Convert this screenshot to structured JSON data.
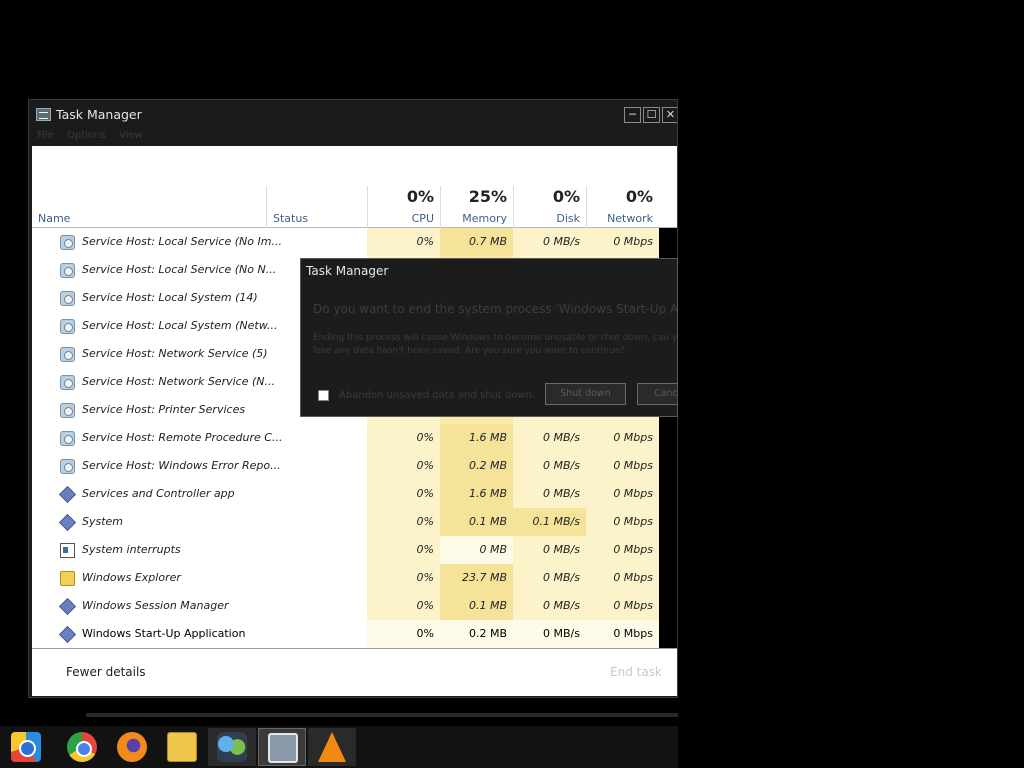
{
  "window": {
    "title": "Task Manager",
    "controls": {
      "minimize": "─",
      "maximize": "☐",
      "close": "✕"
    },
    "menu": [
      "File",
      "Options",
      "View"
    ]
  },
  "columns": {
    "name": "Name",
    "status": "Status",
    "cpu": {
      "percent": "0%",
      "label": "CPU"
    },
    "memory": {
      "percent": "25%",
      "label": "Memory"
    },
    "disk": {
      "percent": "0%",
      "label": "Disk"
    },
    "network": {
      "percent": "0%",
      "label": "Network"
    }
  },
  "processes": [
    {
      "name": "Service Host: Local Service (No Im...",
      "icon": "gear-icon",
      "cpu": "0%",
      "memory": "0.7 MB",
      "disk": "0 MB/s",
      "network": "0 Mbps"
    },
    {
      "name": "Service Host: Local Service (No N...",
      "icon": "gear-icon",
      "cpu": "",
      "memory": "",
      "disk": "",
      "network": ""
    },
    {
      "name": "Service Host: Local System (14)",
      "icon": "gear-icon",
      "cpu": "",
      "memory": "",
      "disk": "",
      "network": ""
    },
    {
      "name": "Service Host: Local System (Netw...",
      "icon": "gear-icon",
      "cpu": "",
      "memory": "",
      "disk": "",
      "network": ""
    },
    {
      "name": "Service Host: Network Service (5)",
      "icon": "gear-icon",
      "cpu": "",
      "memory": "",
      "disk": "",
      "network": ""
    },
    {
      "name": "Service Host: Network Service (N...",
      "icon": "gear-icon",
      "cpu": "",
      "memory": "",
      "disk": "",
      "network": ""
    },
    {
      "name": "Service Host: Printer Services",
      "icon": "gear-icon",
      "cpu": "",
      "memory": "",
      "disk": "",
      "network": ""
    },
    {
      "name": "Service Host: Remote Procedure C...",
      "icon": "gear-icon",
      "cpu": "0%",
      "memory": "1.6 MB",
      "disk": "0 MB/s",
      "network": "0 Mbps"
    },
    {
      "name": "Service Host: Windows Error Repo...",
      "icon": "gear-icon",
      "cpu": "0%",
      "memory": "0.2 MB",
      "disk": "0 MB/s",
      "network": "0 Mbps"
    },
    {
      "name": "Services and Controller app",
      "icon": "diamond-icon",
      "cpu": "0%",
      "memory": "1.6 MB",
      "disk": "0 MB/s",
      "network": "0 Mbps"
    },
    {
      "name": "System",
      "icon": "diamond-icon",
      "cpu": "0%",
      "memory": "0.1 MB",
      "disk": "0.1 MB/s",
      "network": "0 Mbps"
    },
    {
      "name": "System interrupts",
      "icon": "window-icon",
      "cpu": "0%",
      "memory": "0 MB",
      "disk": "0 MB/s",
      "network": "0 Mbps"
    },
    {
      "name": "Windows Explorer",
      "icon": "folder-icon",
      "cpu": "0%",
      "memory": "23.7 MB",
      "disk": "0 MB/s",
      "network": "0 Mbps"
    },
    {
      "name": "Windows Session Manager",
      "icon": "diamond-icon",
      "cpu": "0%",
      "memory": "0.1 MB",
      "disk": "0 MB/s",
      "network": "0 Mbps"
    },
    {
      "name": "Windows Start-Up Application",
      "icon": "diamond-icon",
      "cpu": "0%",
      "memory": "0.2 MB",
      "disk": "0 MB/s",
      "network": "0 Mbps"
    }
  ],
  "footer": {
    "fewer_details": "Fewer details",
    "end_task": "End task"
  },
  "dialog": {
    "title": "Task Manager",
    "question": "Do you want to end the system process 'Windows Start-Up Applicati",
    "description": "Ending this process will cause Windows to become unusable or shut down, cau you to lose any data hasn't been saved. Are you sure you want to continue?",
    "checkbox_label": "Abandon unsaved data and shut down.",
    "shutdown_label": "Shut down",
    "cancel_label": "Cance"
  },
  "taskbar": [
    "chrome-canary-icon",
    "chrome-icon",
    "firefox-icon",
    "file-explorer-icon",
    "messenger-icon",
    "task-manager-icon",
    "vlc-icon"
  ]
}
